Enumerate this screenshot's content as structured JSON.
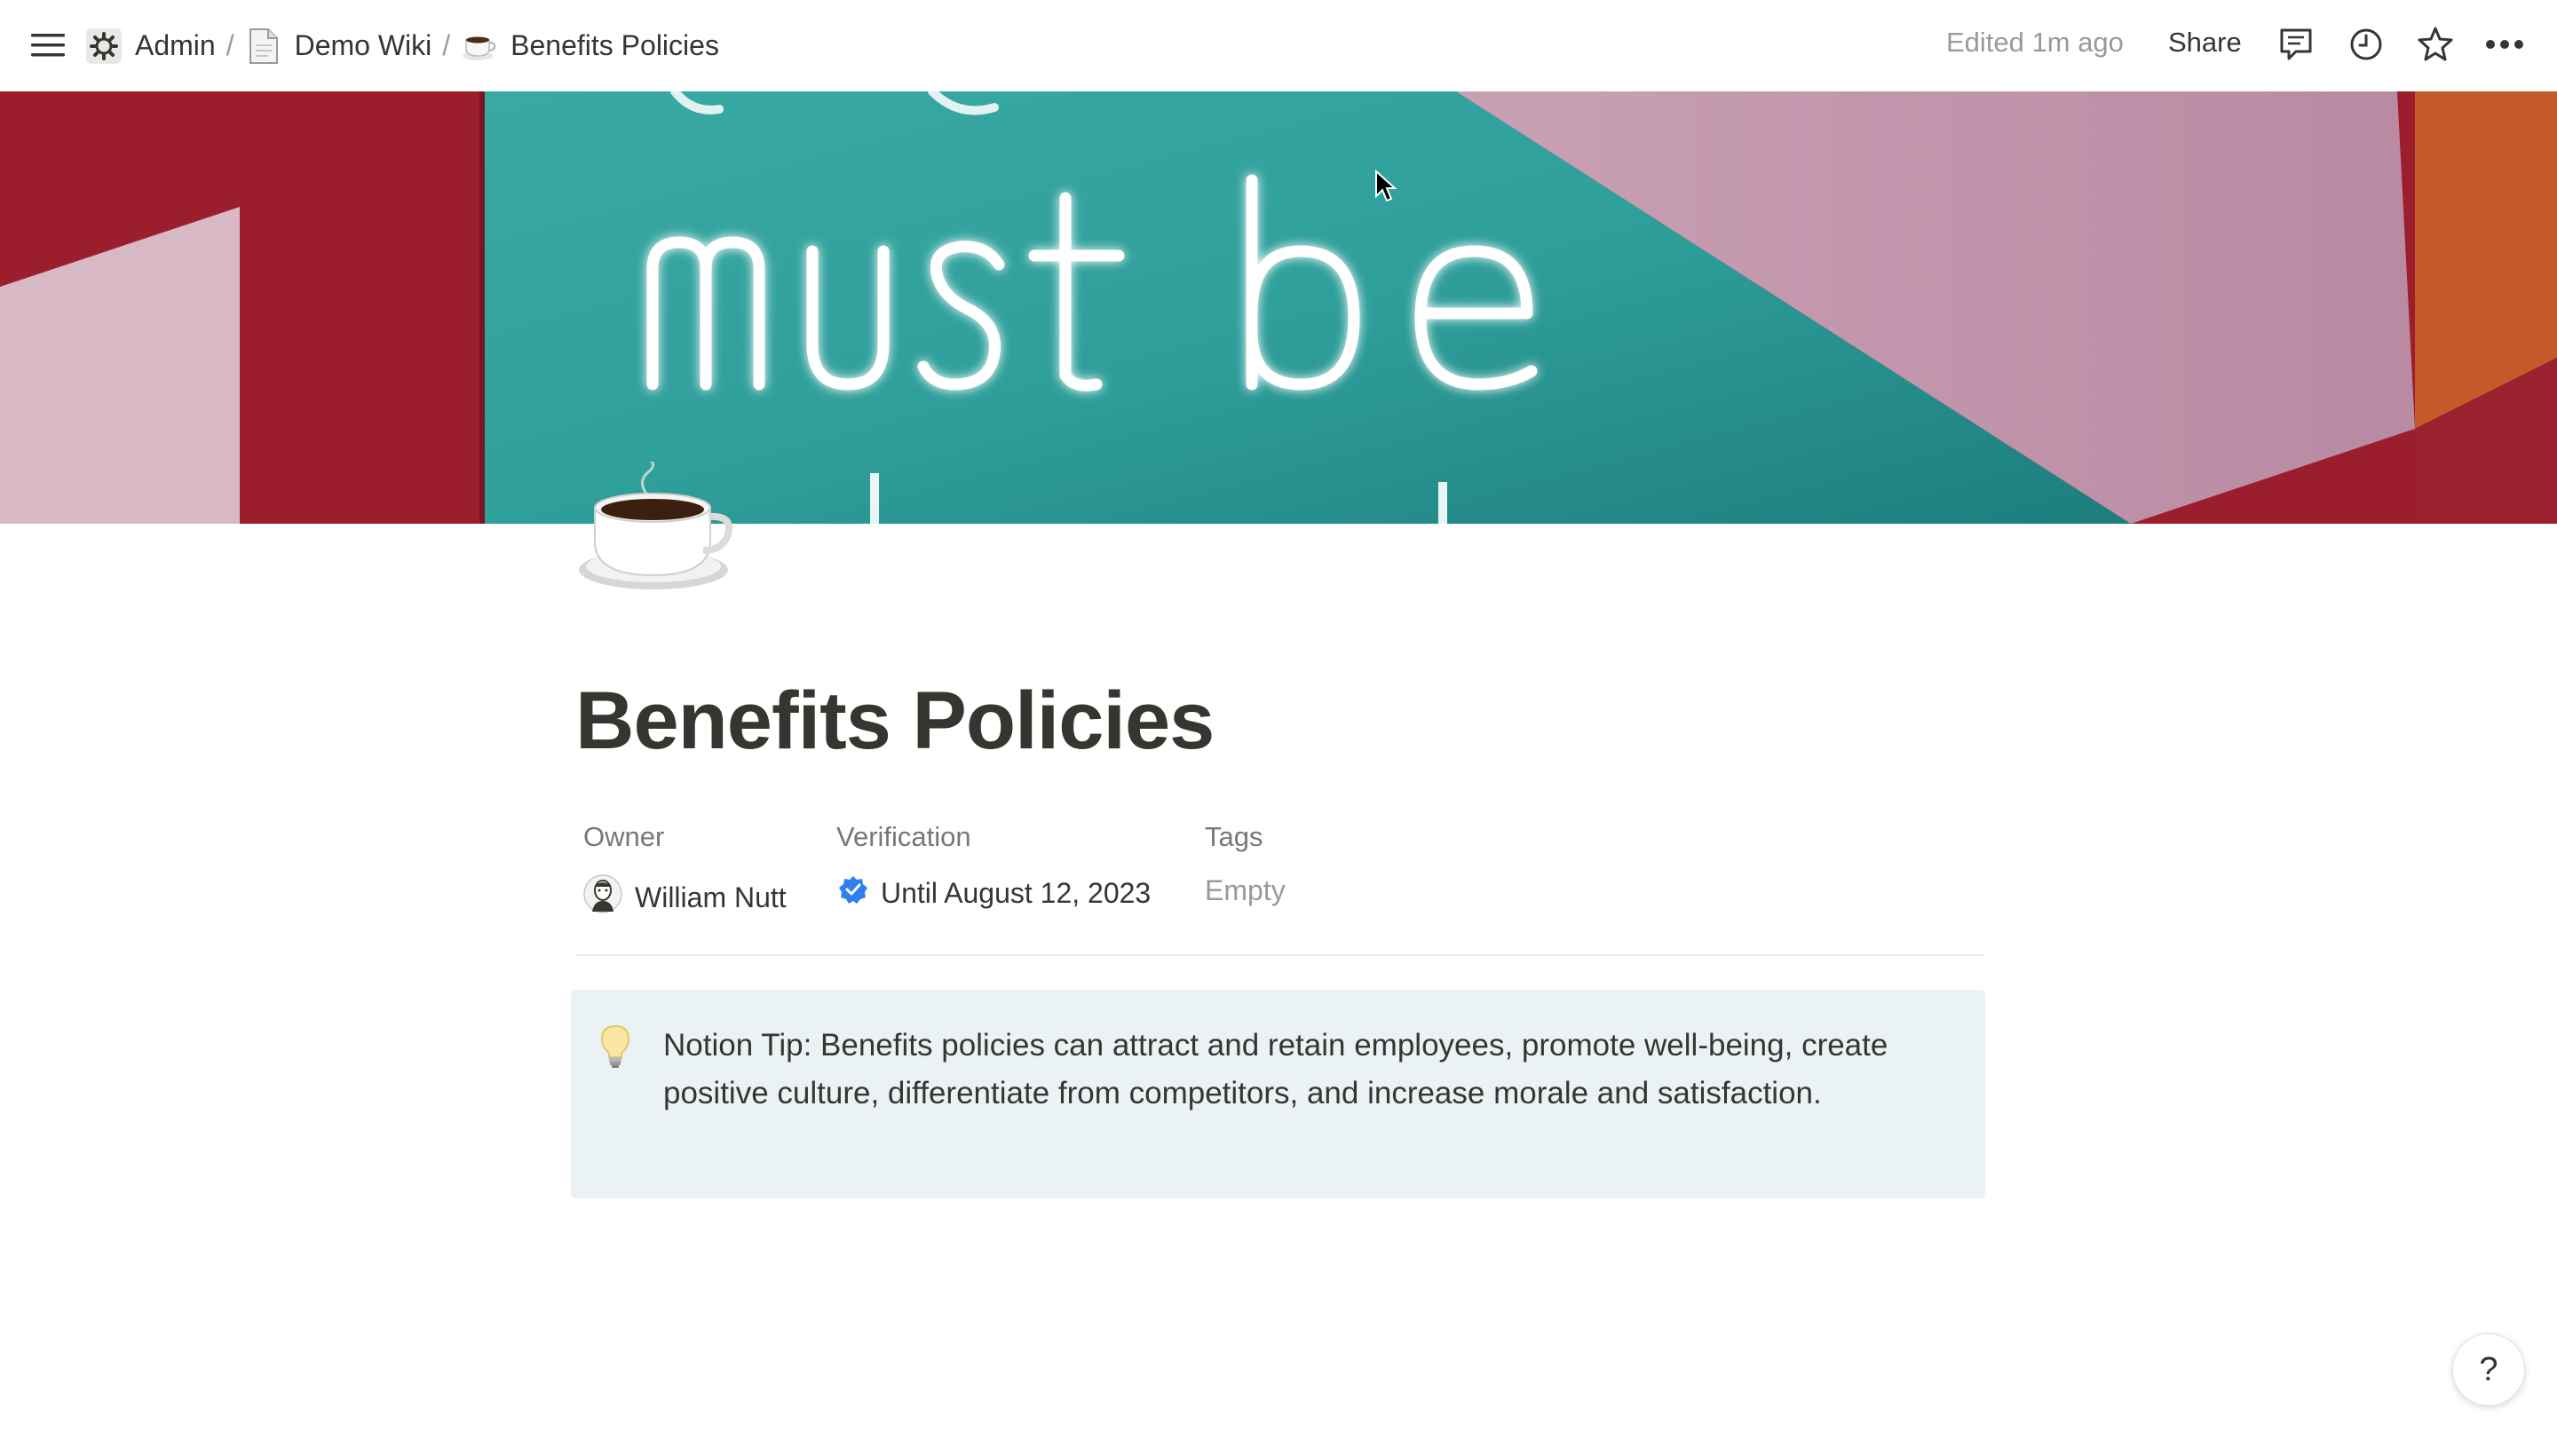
{
  "breadcrumb": {
    "items": [
      {
        "label": "Admin",
        "icon": "gear-icon"
      },
      {
        "label": "Demo Wiki",
        "icon": "document-icon"
      },
      {
        "label": "Benefits Policies",
        "icon": "coffee-icon"
      }
    ],
    "separator": "/"
  },
  "topbar": {
    "edited": "Edited 1m ago",
    "share": "Share",
    "icons": [
      "comments-icon",
      "history-icon",
      "star-icon",
      "more-icon"
    ]
  },
  "cover": {
    "neon_text_line": "must be"
  },
  "page": {
    "icon": "☕",
    "title": "Benefits Policies"
  },
  "properties": {
    "owner": {
      "label": "Owner",
      "value": "William Nutt"
    },
    "verification": {
      "label": "Verification",
      "value": "Until August 12, 2023"
    },
    "tags": {
      "label": "Tags",
      "value": "Empty"
    }
  },
  "callout": {
    "icon": "lightbulb-icon",
    "text": "Notion Tip: Benefits policies can attract and retain employees, promote well-being, create positive culture, differentiate from competitors, and increase morale and satisfaction."
  },
  "help": {
    "label": "?"
  },
  "colors": {
    "text": "#37352f",
    "muted": "#9b9a97",
    "callout_bg": "#ebf2f5",
    "verified": "#2f80ed"
  }
}
